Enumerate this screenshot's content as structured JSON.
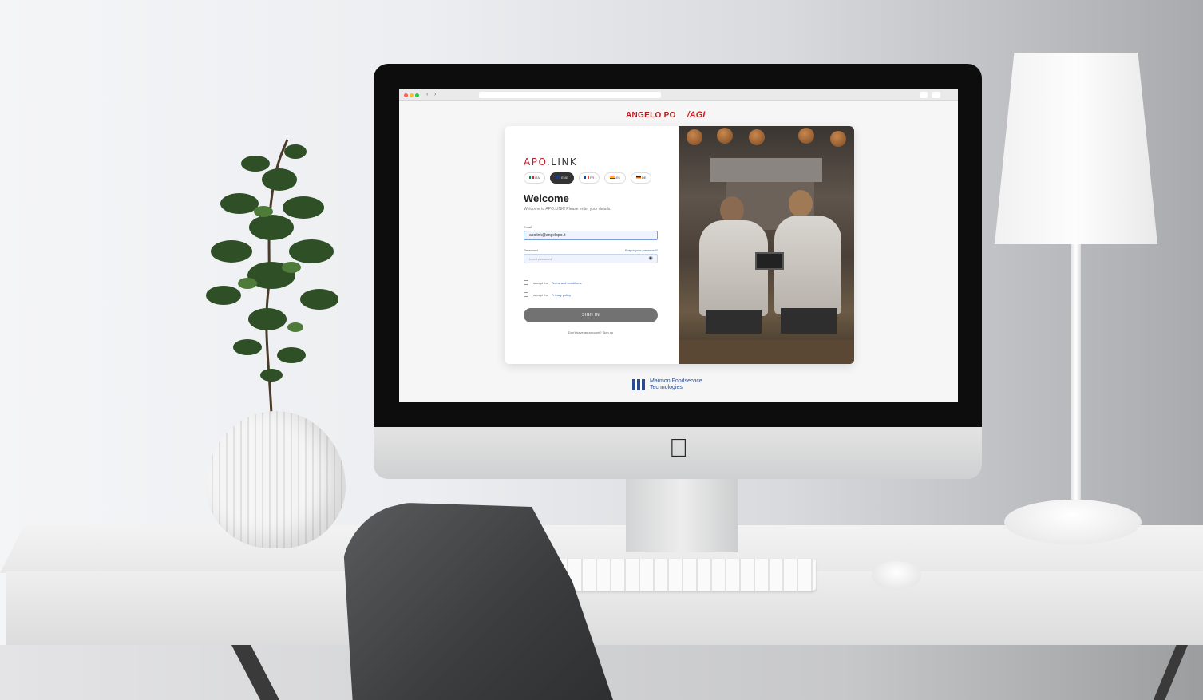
{
  "colors": {
    "brand_red": "#c41f2c",
    "button_gray": "#727272",
    "link_blue": "#2c5fb7",
    "footer_blue": "#2a4c8f"
  },
  "brands": {
    "angelo_po": "ANGELO PO",
    "sagi": "/AGI"
  },
  "login": {
    "logo_prefix": "APO",
    "logo_suffix": ".LINK",
    "languages": [
      {
        "code": "ITA",
        "flag": "italy-flag-icon"
      },
      {
        "code": "ENG",
        "flag": "uk-flag-icon",
        "active": true
      },
      {
        "code": "FR",
        "flag": "france-flag-icon"
      },
      {
        "code": "ES",
        "flag": "spain-flag-icon"
      },
      {
        "code": "DE",
        "flag": "germany-flag-icon"
      }
    ],
    "title": "Welcome",
    "subtitle": "Welcome to APO.LINK! Please enter your details.",
    "email_label": "Email",
    "email_value": "apolink@angelopo.it",
    "password_label": "Password",
    "forgot_password": "Forgot your password?",
    "password_placeholder": "Insert password",
    "accept_terms": "I accept the",
    "terms_link": "Terms and conditions",
    "accept_privacy": "I accept the",
    "privacy_link": "Privacy policy",
    "sign_in": "SIGN IN",
    "signup_text": "Don't have an account? Sign up"
  },
  "footer": {
    "line1": "Marmon Foodservice",
    "line2": "Technologies"
  }
}
